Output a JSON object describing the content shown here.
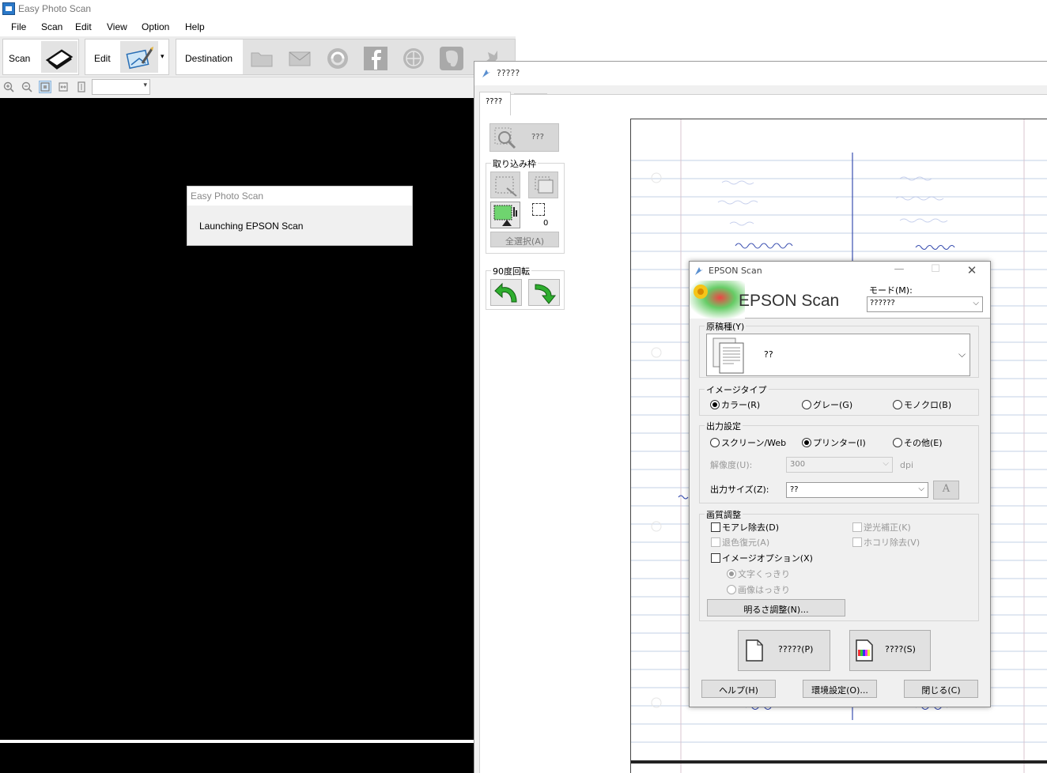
{
  "app": {
    "title": "Easy Photo Scan",
    "menu": [
      "File",
      "Scan",
      "Edit",
      "View",
      "Option",
      "Help"
    ],
    "toolbar": {
      "scan_label": "Scan",
      "edit_label": "Edit",
      "destination_label": "Destination",
      "destination_icons": [
        "folder-icon",
        "mail-icon",
        "web-sync-icon",
        "facebook-icon",
        "globe-icon",
        "evernote-icon",
        "bird-icon"
      ]
    },
    "zoom": {
      "selected": ""
    },
    "launch_dialog": {
      "title": "Easy Photo Scan",
      "message": "Launching EPSON Scan"
    }
  },
  "preview_window": {
    "title": "?????",
    "tabs": [
      "????",
      "?????"
    ],
    "zoom_button_label": "???",
    "marquee_legend": "取り込み枠",
    "marquee_count": "0",
    "select_all_label": "全選択(A)",
    "rotate_legend": "90度回転"
  },
  "epson": {
    "title": "EPSON Scan",
    "brand": "EPSON Scan",
    "mode_label": "モード(M):",
    "mode_value": "??????",
    "document_type_legend": "原稿種(Y)",
    "document_type_value": "??",
    "image_type": {
      "legend": "イメージタイプ",
      "options": [
        "カラー(R)",
        "グレー(G)",
        "モノクロ(B)"
      ],
      "selected": "カラー(R)"
    },
    "output": {
      "legend": "出力設定",
      "options": [
        "スクリーン/Web",
        "プリンター(I)",
        "その他(E)"
      ],
      "selected": "プリンター(I)",
      "resolution_label": "解像度(U):",
      "resolution_value": "300",
      "resolution_unit": "dpi",
      "size_label": "出力サイズ(Z):",
      "size_value": "??"
    },
    "quality": {
      "legend": "画質調整",
      "moire": "モアレ除去(D)",
      "backlight": "逆光補正(K)",
      "fade": "退色復元(A)",
      "dust": "ホコリ除去(V)",
      "image_option": "イメージオプション(X)",
      "text_sharp": "文字くっきり",
      "image_sharp": "画像はっきり",
      "brightness_button": "明るさ調整(N)..."
    },
    "preview_button": "?????(P)",
    "scan_button": "????(S)",
    "help_button": "ヘルプ(H)",
    "config_button": "環境設定(O)...",
    "close_button": "閉じる(C)"
  },
  "colors": {
    "preview_background": "#000000",
    "rotate_arrow": "#22aa22",
    "ink": "#3a4fb0"
  }
}
